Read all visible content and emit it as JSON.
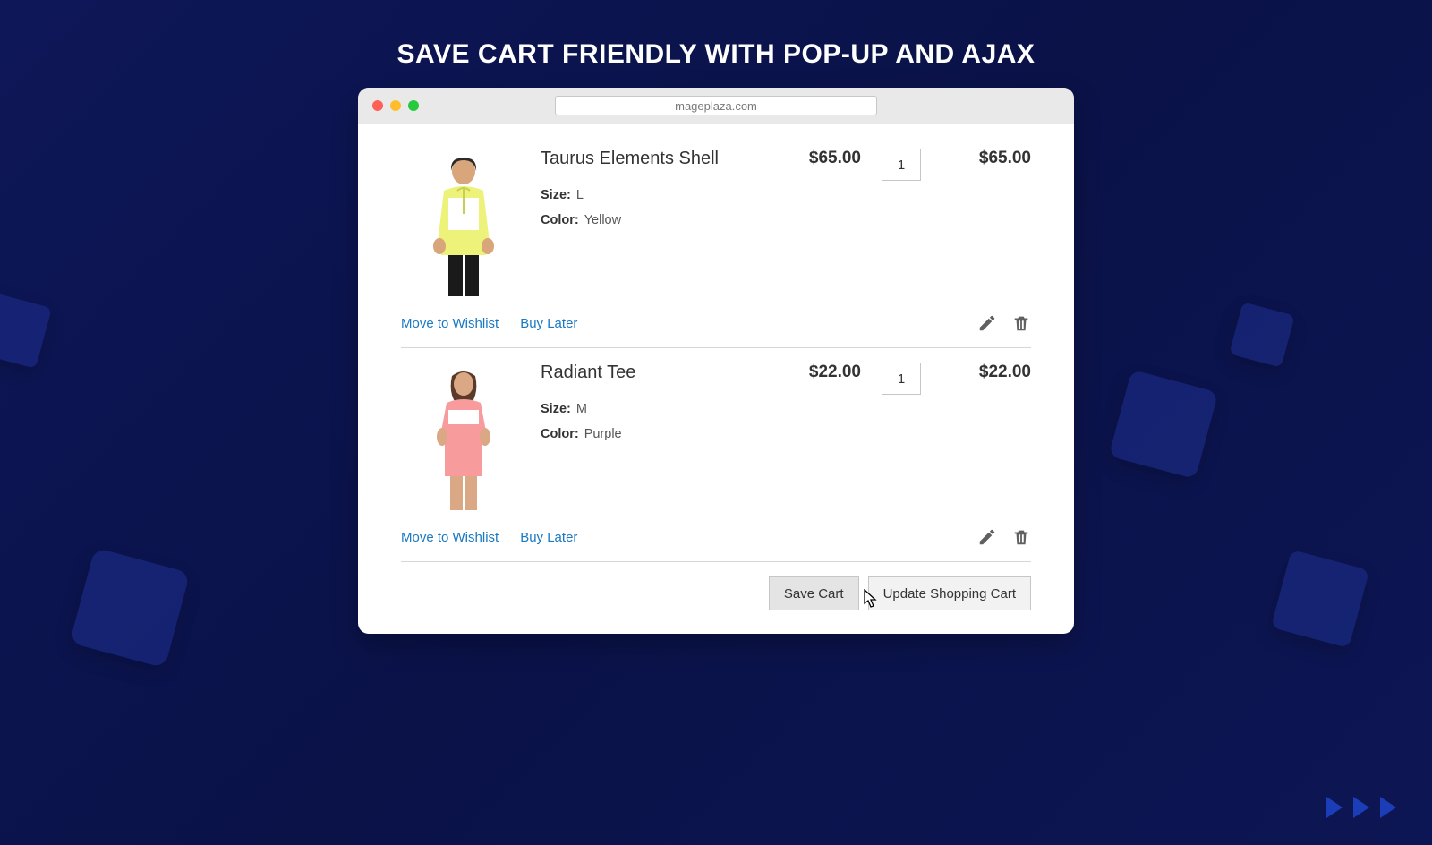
{
  "page": {
    "headline": "SAVE CART FRIENDLY WITH POP-UP AND AJAX",
    "url": "mageplaza.com"
  },
  "labels": {
    "size": "Size:",
    "color": "Color:",
    "move_to_wishlist": "Move to Wishlist",
    "buy_later": "Buy Later"
  },
  "items": [
    {
      "name": "Taurus Elements Shell",
      "size": "L",
      "color": "Yellow",
      "price": "$65.00",
      "qty": "1",
      "subtotal": "$65.00"
    },
    {
      "name": "Radiant Tee",
      "size": "M",
      "color": "Purple",
      "price": "$22.00",
      "qty": "1",
      "subtotal": "$22.00"
    }
  ],
  "buttons": {
    "save_cart": "Save Cart",
    "update_cart": "Update Shopping Cart"
  }
}
